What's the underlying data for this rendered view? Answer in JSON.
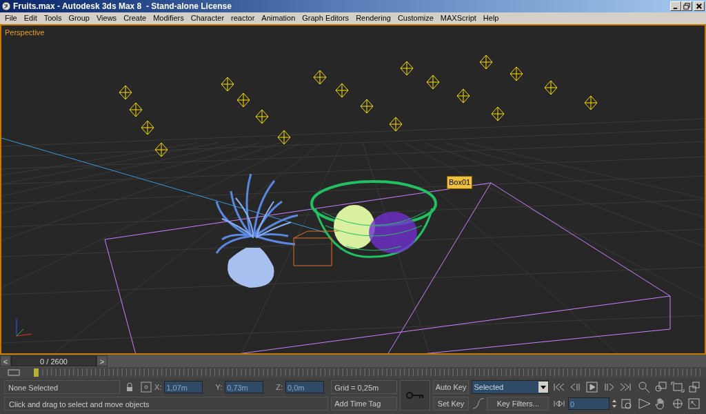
{
  "window": {
    "title": "Fruits.max - Autodesk 3ds Max 8  - Stand-alone License"
  },
  "menu": [
    "File",
    "Edit",
    "Tools",
    "Group",
    "Views",
    "Create",
    "Modifiers",
    "Character",
    "reactor",
    "Animation",
    "Graph Editors",
    "Rendering",
    "Customize",
    "MAXScript",
    "Help"
  ],
  "viewport": {
    "label": "Perspective",
    "object_tag": "Box01"
  },
  "time_slider": {
    "prev": "<",
    "frame": "0 / 2600",
    "level": 0,
    "next": ">"
  },
  "status": {
    "selection": "None Selected",
    "prompt": "Click and drag to select and move objects",
    "x_label": "X:",
    "x": "1,07m",
    "y_label": "Y:",
    "y": "0,73m",
    "z_label": "Z:",
    "z": "0,0m",
    "grid": "Grid = 0,25m",
    "add_time_tag": "Add Time Tag"
  },
  "animation": {
    "auto_key": "Auto Key",
    "set_key": "Set Key",
    "key_mode": "Selected",
    "key_filters": "Key Filters...",
    "current_frame": "0"
  }
}
